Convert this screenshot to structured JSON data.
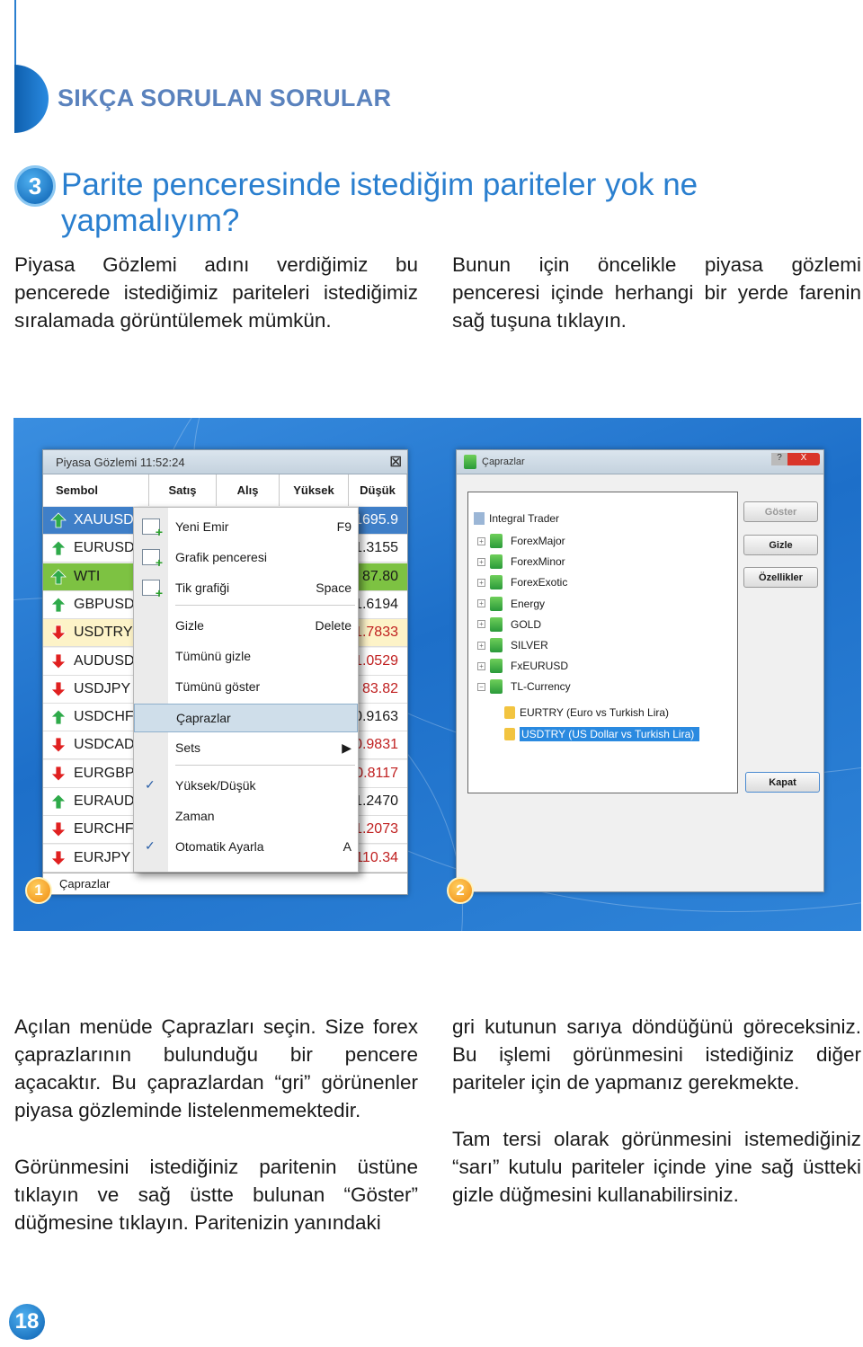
{
  "header": {
    "section_title": "SIKÇA SORULAN SORULAR",
    "question_number": "3",
    "question": "Parite penceresinde istediğim pariteler yok ne yapmalıyım?"
  },
  "intro": {
    "left": "Piyasa Gözlemi adını verdiğimiz bu pencerede istediğimiz pariteleri istediğimiz sıralamada görüntülemek mümkün.",
    "right": "Bunun için öncelikle piyasa gözlemi penceresi içinde herhangi bir yerde farenin sağ tuşuna tıklayın."
  },
  "market_watch": {
    "title": "Piyasa Gözlemi 11:52:24",
    "columns": [
      "Sembol",
      "Satış",
      "Alış",
      "Yüksek",
      "Düşük"
    ],
    "rows": [
      {
        "symbol": "XAUUSD",
        "value": "1695.9",
        "dir": "up",
        "state": "selected"
      },
      {
        "symbol": "EURUSD",
        "value": "1.3155",
        "dir": "up",
        "state": "normal"
      },
      {
        "symbol": "WTI",
        "value": "87.80",
        "dir": "up",
        "state": "green"
      },
      {
        "symbol": "GBPUSD",
        "value": "1.6194",
        "dir": "up",
        "state": "normal"
      },
      {
        "symbol": "USDTRY",
        "value": "1.7833",
        "dir": "down",
        "state": "yellow"
      },
      {
        "symbol": "AUDUSD",
        "value": "1.0529",
        "dir": "down",
        "state": "normal"
      },
      {
        "symbol": "USDJPY",
        "value": "83.82",
        "dir": "down",
        "state": "normal"
      },
      {
        "symbol": "USDCHF",
        "value": "0.9163",
        "dir": "up",
        "state": "normal"
      },
      {
        "symbol": "USDCAD",
        "value": "0.9831",
        "dir": "down",
        "state": "normal"
      },
      {
        "symbol": "EURGBP",
        "value": "0.8117",
        "dir": "down",
        "state": "normal"
      },
      {
        "symbol": "EURAUD",
        "value": "1.2470",
        "dir": "up",
        "state": "normal"
      },
      {
        "symbol": "EURCHF",
        "value": "1.2073",
        "dir": "down",
        "state": "normal"
      },
      {
        "symbol": "EURJPY",
        "value": "110.34",
        "dir": "down",
        "state": "normal"
      }
    ],
    "footer_tab": "Çaprazlar",
    "context_menu": [
      {
        "label": "Yeni Emir",
        "shortcut": "F9",
        "icon": "new-order-icon"
      },
      {
        "label": "Grafik penceresi",
        "shortcut": "",
        "icon": "chart-window-icon"
      },
      {
        "label": "Tik grafiği",
        "shortcut": "Space",
        "icon": "tick-chart-icon"
      },
      {
        "label": "Gizle",
        "shortcut": "Delete"
      },
      {
        "label": "Tümünü gizle",
        "shortcut": ""
      },
      {
        "label": "Tümünü göster",
        "shortcut": ""
      },
      {
        "label": "Çaprazlar",
        "shortcut": "",
        "highlighted": true
      },
      {
        "label": "Sets",
        "shortcut": "▶"
      },
      {
        "label": "Yüksek/Düşük",
        "shortcut": "",
        "checked": true
      },
      {
        "label": "Zaman",
        "shortcut": ""
      },
      {
        "label": "Otomatik Ayarla",
        "shortcut": "A",
        "checked": true
      }
    ]
  },
  "crosses_dialog": {
    "title": "Çaprazlar",
    "tree_root": "Integral Trader",
    "groups": [
      "ForexMajor",
      "ForexMinor",
      "ForexExotic",
      "Energy",
      "GOLD",
      "SILVER",
      "FxEURUSD",
      "TL-Currency"
    ],
    "leaves": [
      "EURTRY (Euro vs Turkish Lira)",
      "USDTRY (US Dollar vs Turkish Lira)"
    ],
    "buttons": {
      "show": "Göster",
      "hide": "Gizle",
      "properties": "Özellikler",
      "close": "Kapat"
    }
  },
  "step_badges": [
    "1",
    "2"
  ],
  "body": {
    "left_p1": "Açılan menüde Çaprazları seçin. Size forex çaprazlarının bulunduğu bir pencere açacaktır. Bu çaprazlardan “gri” görünenler piyasa gözleminde listelenmemektedir.",
    "left_p2": "Görünmesini istediğiniz paritenin üstüne tıklayın ve sağ üstte bulunan “Göster” düğmesine tıklayın. Paritenizin yanındaki",
    "right_p1": "gri kutunun sarıya döndüğünü göreceksiniz. Bu işlemi görünmesini istediğiniz diğer pariteler için de yapmanız gerekmekte.",
    "right_p2": "Tam tersi olarak görünmesini istemediğiniz “sarı” kutulu pariteler içinde yine sağ üstteki gizle düğmesini kullanabilirsiniz."
  },
  "page_number": "18",
  "colors": {
    "accent": "#2a7fcf",
    "selected_row": "#3f7fc8",
    "green_row": "#7dc242",
    "yellow_row": "#fdf3c8",
    "up": "#2eaa4a",
    "down": "#e02020",
    "badge": "#f59a1a"
  }
}
